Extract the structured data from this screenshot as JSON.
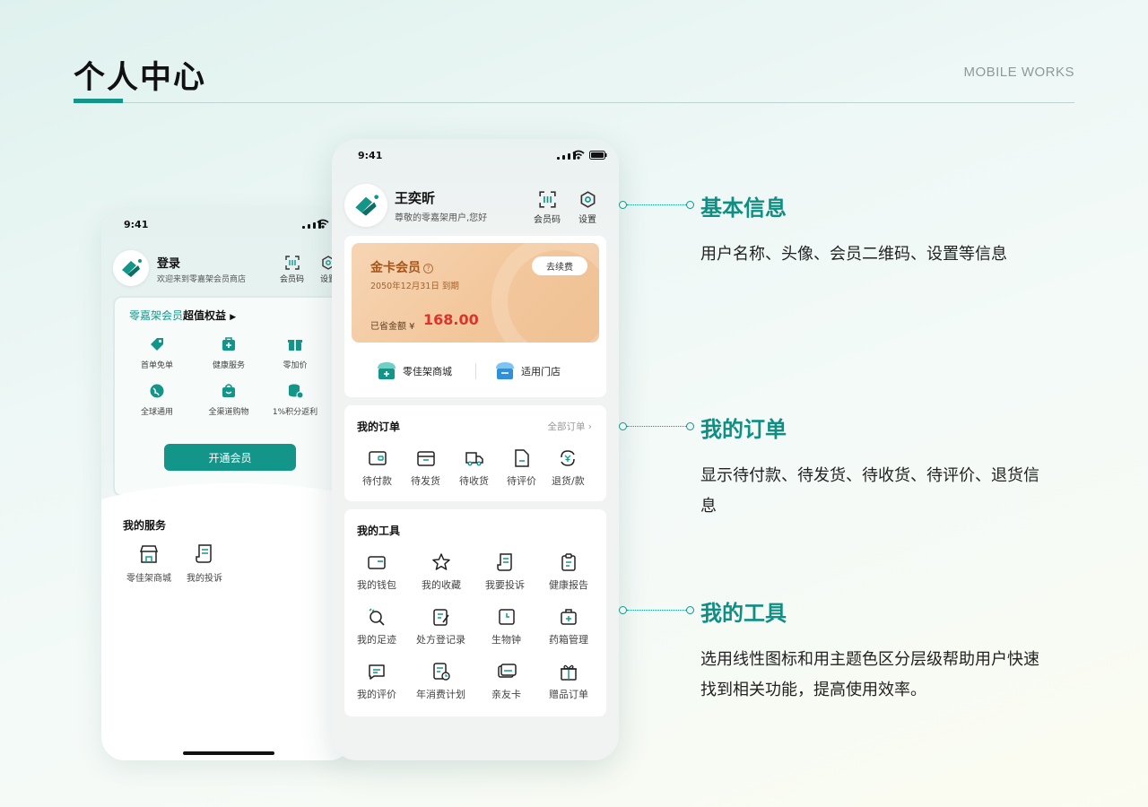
{
  "header": {
    "title": "个人中心",
    "label": "MOBILE WORKS"
  },
  "back_phone": {
    "time": "9:41",
    "name": "登录",
    "welcome": "欢迎来到零嘉架会员商店",
    "btn_qr": "会员码",
    "btn_settings": "设置",
    "member_brand": "零嘉架会员",
    "member_rest": "超值权益",
    "benefits": [
      "首单免单",
      "健康服务",
      "零加价",
      "全球通用",
      "全渠道购物",
      "1%积分返利"
    ],
    "open_button": "开通会员",
    "services_title": "我的服务",
    "services": [
      "零佳架商城",
      "我的投诉"
    ]
  },
  "front_phone": {
    "time": "9:41",
    "name": "王奕昕",
    "greeting": "尊敬的零嘉架用户,您好",
    "btn_qr": "会员码",
    "btn_settings": "设置",
    "card": {
      "title": "金卡会员",
      "help": "?",
      "expire": "2050年12月31日 到期",
      "renew": "去续费",
      "saved_label": "已省金额 ¥",
      "saved_amount": "168.00"
    },
    "entries": [
      "零佳架商城",
      "适用门店"
    ],
    "orders": {
      "title": "我的订单",
      "all": "全部订单 ›",
      "items": [
        "待付款",
        "待发货",
        "待收货",
        "待评价",
        "退货/款"
      ]
    },
    "tools": {
      "title": "我的工具",
      "items": [
        "我的钱包",
        "我的收藏",
        "我要投诉",
        "健康报告",
        "我的足迹",
        "处方登记录",
        "生物钟",
        "药箱管理",
        "我的评价",
        "年消费计划",
        "亲友卡",
        "赠品订单"
      ]
    }
  },
  "annotations": [
    {
      "title": "基本信息",
      "desc": "用户名称、头像、会员二维码、设置等信息"
    },
    {
      "title": "我的订单",
      "desc": "显示待付款、待发货、待收货、待评价、退货信息"
    },
    {
      "title": "我的工具",
      "desc": "选用线性图标和用主题色区分层级帮助用户快速找到相关功能，提高使用效率。"
    }
  ],
  "colors": {
    "accent": "#14958a",
    "gold": "#f3c79c",
    "price_red": "#d9352c"
  }
}
